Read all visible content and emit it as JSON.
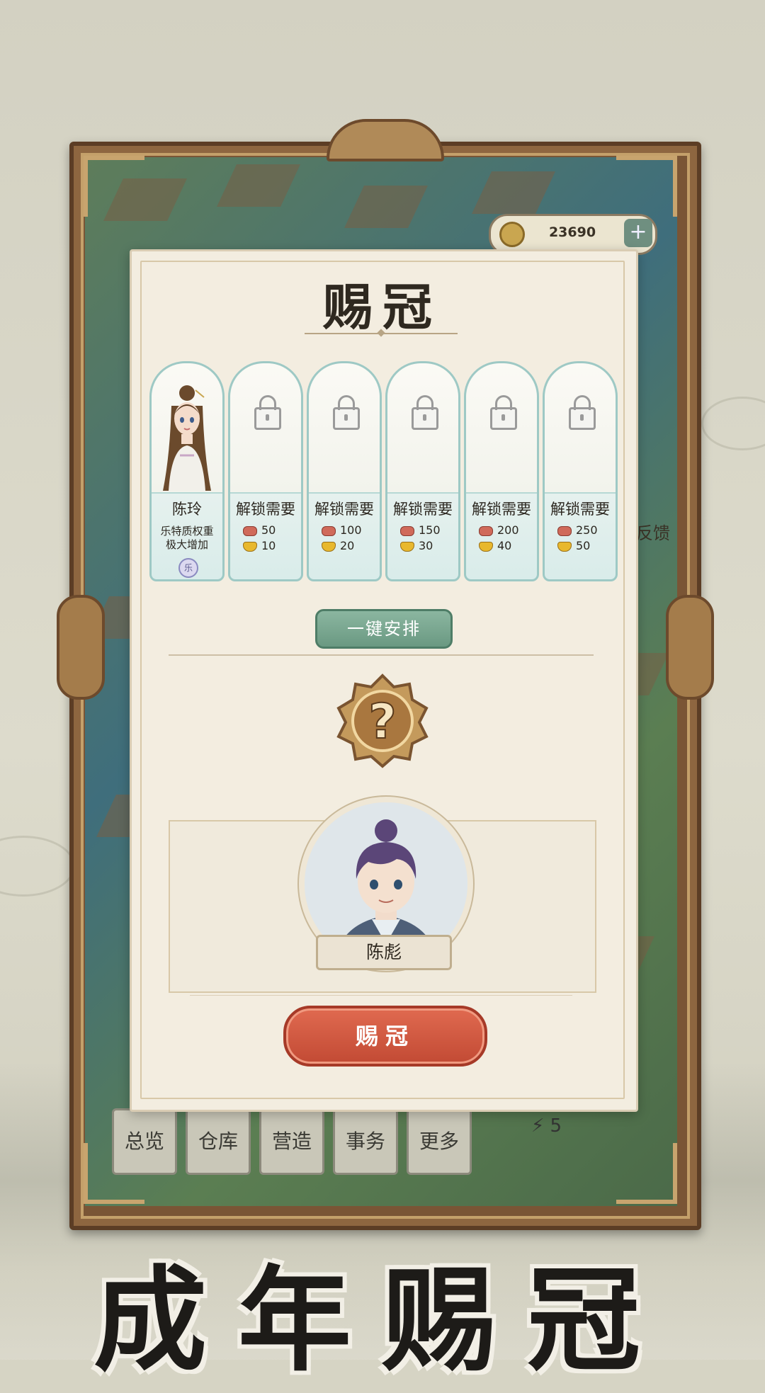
{
  "header": {
    "currency_value": "23690",
    "currency_plus": "+"
  },
  "modal": {
    "title": "赐冠",
    "cards": [
      {
        "name": "陈玲",
        "unlocked": true,
        "desc_line1": "乐特质权重",
        "desc_line2": "极大增加",
        "badge": "乐"
      },
      {
        "name": "解锁需要",
        "unlocked": false,
        "req_a": "50",
        "req_b": "10"
      },
      {
        "name": "解锁需要",
        "unlocked": false,
        "req_a": "100",
        "req_b": "20"
      },
      {
        "name": "解锁需要",
        "unlocked": false,
        "req_a": "150",
        "req_b": "30"
      },
      {
        "name": "解锁需要",
        "unlocked": false,
        "req_a": "200",
        "req_b": "40"
      },
      {
        "name": "解锁需要",
        "unlocked": false,
        "req_a": "250",
        "req_b": "50"
      }
    ],
    "auto_button": "一键安排",
    "mystery_symbol": "?",
    "character_name": "陈彪",
    "confirm_button": "赐冠"
  },
  "nav": {
    "items": [
      "总览",
      "仓库",
      "营造",
      "事务",
      "更多"
    ]
  },
  "energy": {
    "value": "5"
  },
  "side_label": "反馈",
  "caption": "成年赐冠",
  "colors": {
    "accent_green": "#6a9982",
    "confirm_red": "#c24a34",
    "frame_wood": "#7a5535"
  }
}
